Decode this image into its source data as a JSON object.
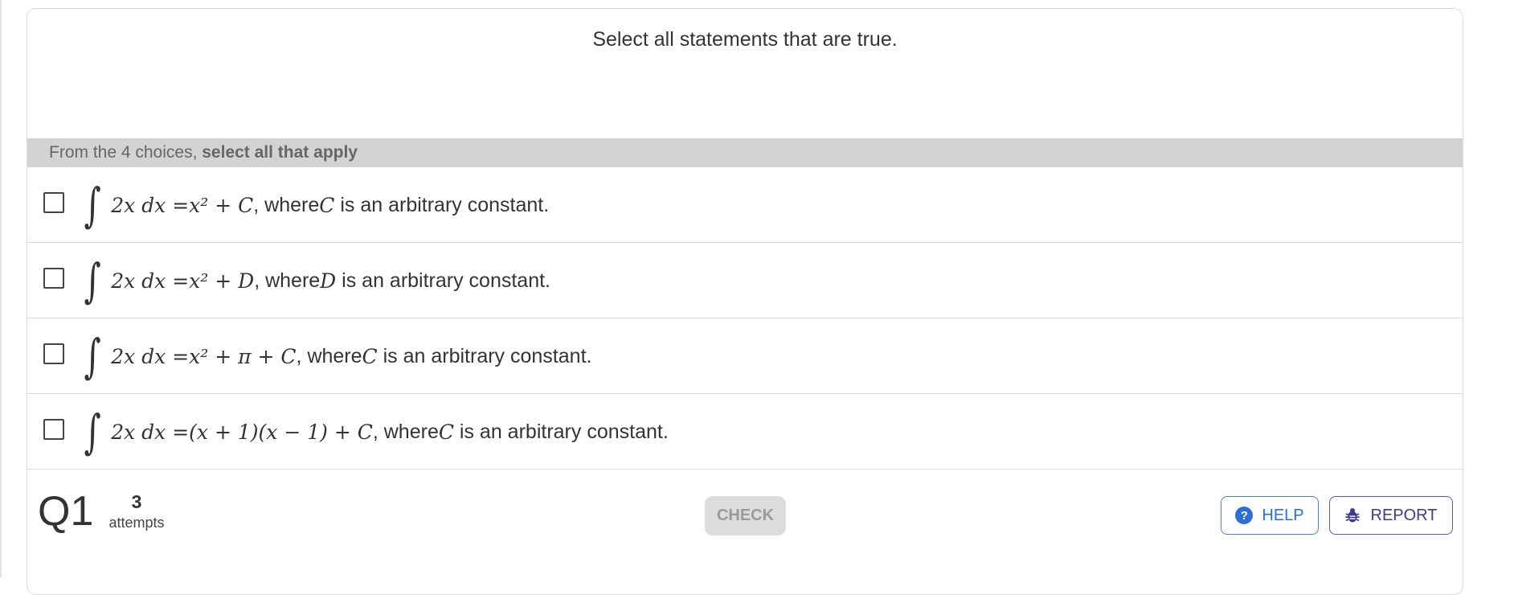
{
  "question": {
    "prompt": "Select all statements that are true.",
    "instruction_prefix": "From the 4 choices, ",
    "instruction_bold": "select all that apply"
  },
  "choices": [
    {
      "math": [
        "2",
        "x",
        " d",
        "x",
        " = ",
        "x",
        "2",
        " + ",
        "C"
      ],
      "rhs": "x² + C",
      "suffix_before": ", where ",
      "var": "C",
      "suffix_after": " is an arbitrary constant.",
      "checked": false
    },
    {
      "rhs": "x² + D",
      "suffix_before": ", where ",
      "var": "D",
      "suffix_after": " is an arbitrary constant.",
      "checked": false
    },
    {
      "rhs": "x² + π + C",
      "suffix_before": ", where ",
      "var": "C",
      "suffix_after": " is an arbitrary constant.",
      "checked": false
    },
    {
      "rhs": "(x + 1)(x − 1) + C",
      "suffix_before": ", where ",
      "var": "C",
      "suffix_after": " is an arbitrary constant.",
      "checked": false
    }
  ],
  "integral_lhs": "2x dx = ",
  "footer": {
    "question_label": "Q1",
    "attempts_count": "3",
    "attempts_label": "attempts",
    "check_label": "CHECK",
    "help_label": "HELP",
    "report_label": "REPORT"
  },
  "colors": {
    "help": "#2e6fd6",
    "report": "#3f3a8c",
    "instruction_bar": "#d3d3d3"
  },
  "icons": [
    "question-circle-icon",
    "bug-icon"
  ]
}
